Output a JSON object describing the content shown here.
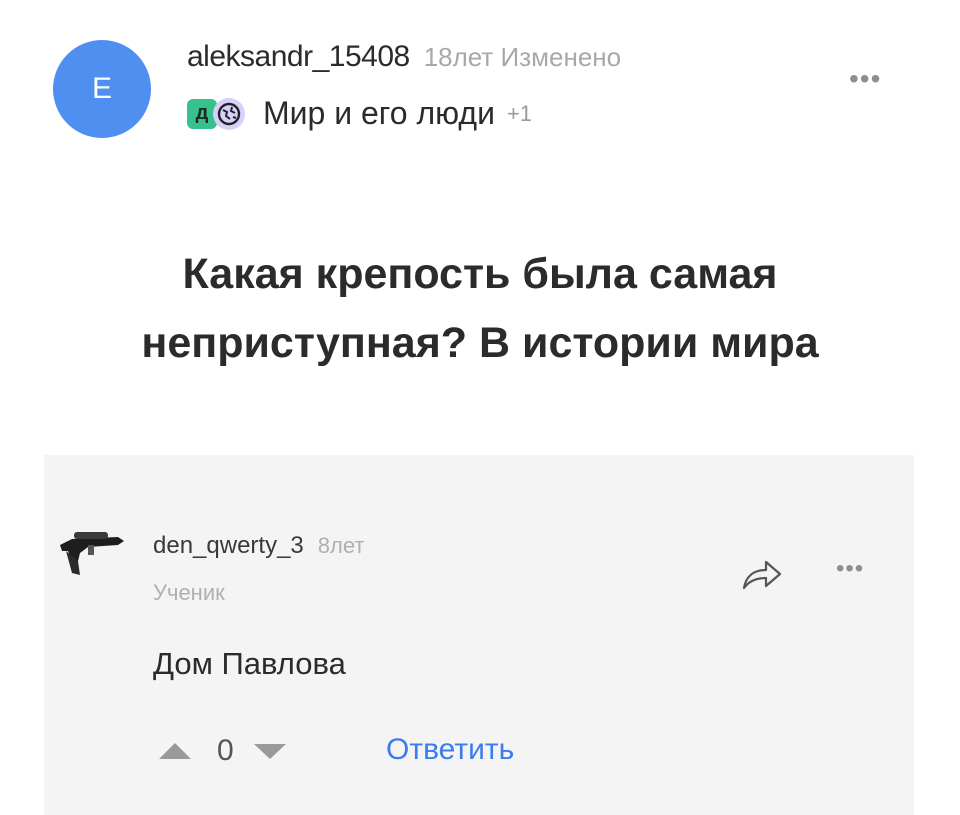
{
  "post": {
    "avatar_letter": "E",
    "author": "aleksandr_15408",
    "time": "18лет",
    "edited": "Изменено",
    "category_icon_text": "д",
    "category": "Мир и его люди",
    "category_extra": "+1",
    "more": "•••",
    "question": "Какая крепость была самая неприступная? В истории мира"
  },
  "answer": {
    "author": "den_qwerty_3",
    "time": "8лет",
    "rank": "Ученик",
    "more": "•••",
    "text": "Дом Павлова",
    "votes": "0",
    "reply_label": "Ответить"
  },
  "icons": {
    "post_avatar": "letter-avatar",
    "category_badge": "d-badge-icon",
    "category_planet": "planet-icon",
    "answer_avatar": "rifle-icon",
    "share": "share-arrow-icon",
    "upvote": "triangle-up-icon",
    "downvote": "triangle-down-icon"
  },
  "colors": {
    "avatar_bg": "#4f8ff0",
    "reply_link": "#3b7cf0",
    "category_green": "#36c28c",
    "category_purple": "#d9cffb",
    "answer_bg": "#f4f4f4"
  }
}
